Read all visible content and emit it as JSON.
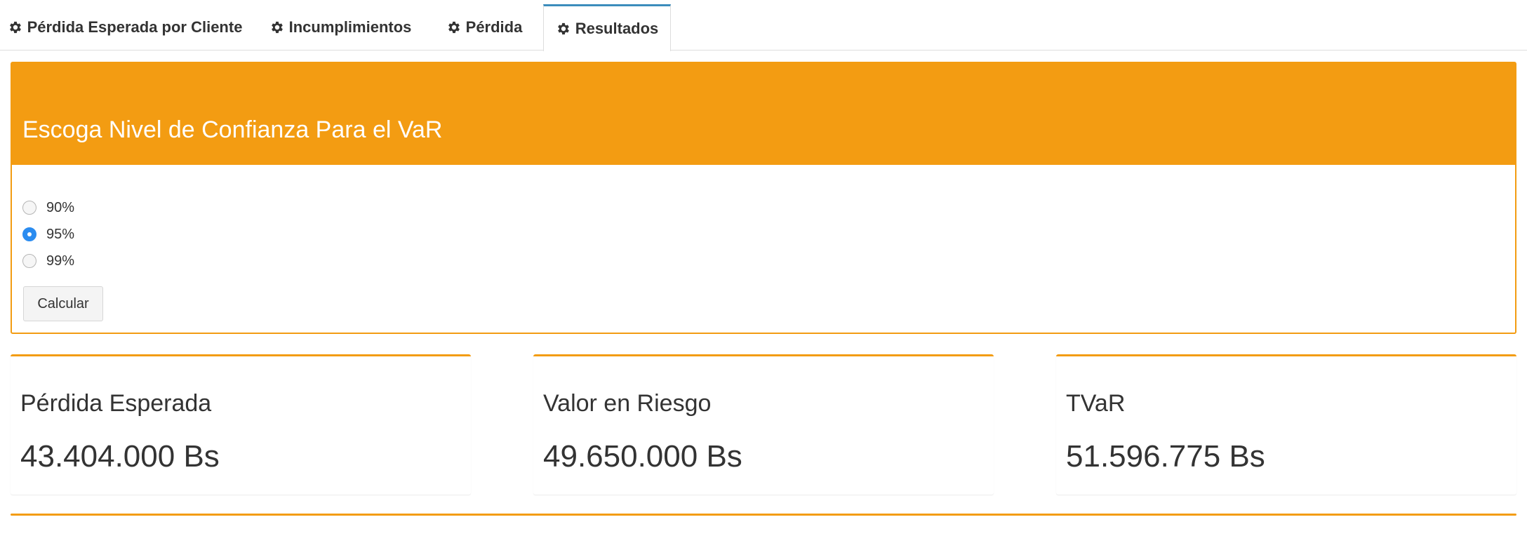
{
  "tabs": [
    {
      "label": "Pérdida Esperada por Cliente",
      "icon": "gear-icon",
      "active": false
    },
    {
      "label": "Incumplimientos",
      "icon": "gear-icon",
      "active": false
    },
    {
      "label": "Pérdida",
      "icon": "gear-icon",
      "active": false
    },
    {
      "label": "Resultados",
      "icon": "gear-icon",
      "active": true
    }
  ],
  "confidence": {
    "title": "Escoga Nivel de Confianza Para el VaR",
    "options": [
      "90%",
      "95%",
      "99%"
    ],
    "selected": "95%",
    "button_label": "Calcular"
  },
  "results": [
    {
      "label": "Pérdida Esperada",
      "value": "43.404.000 Bs"
    },
    {
      "label": "Valor en Riesgo",
      "value": "49.650.000 Bs"
    },
    {
      "label": "TVaR",
      "value": "51.596.775 Bs"
    }
  ],
  "colors": {
    "accent": "#f39c12",
    "tab_active_border": "#3c8dbc",
    "radio_checked": "#2b8cf0"
  }
}
